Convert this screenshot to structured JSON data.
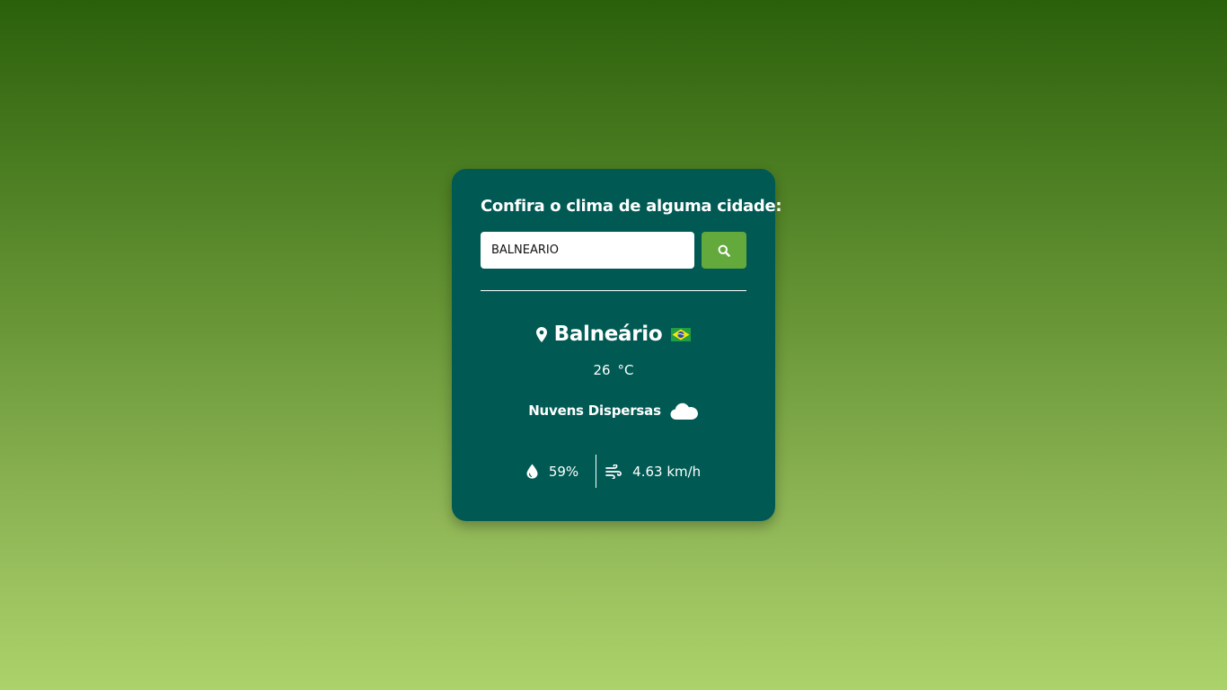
{
  "weather_card": {
    "title": "Confira o clima de alguma cidade:",
    "search": {
      "value": "BALNEÁRIO",
      "button_icon": "search-icon"
    },
    "city": {
      "name": "Balneário",
      "location_icon": "map-pin-icon",
      "flag_icon": "brazil-flag-icon"
    },
    "temperature": {
      "value": "26",
      "unit": "°C"
    },
    "description": {
      "text": "Nuvens Dispersas",
      "icon": "cloud-icon"
    },
    "humidity": {
      "value": "59%",
      "icon": "droplet-icon"
    },
    "wind": {
      "value": "4.63 km/h",
      "icon": "wind-icon"
    }
  },
  "colors": {
    "card_background": "#005a53",
    "search_button": "#63a93c",
    "gradient_top": "#2b600b",
    "gradient_bottom": "#acd36a"
  }
}
